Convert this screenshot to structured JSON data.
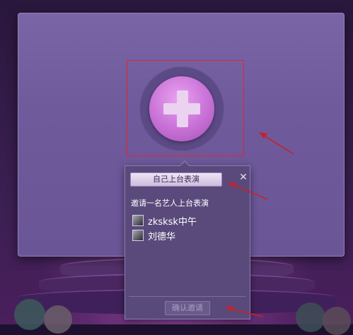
{
  "stage": {
    "add_button_icon": "plus-icon",
    "colors": {
      "panel": "#6f5a9c",
      "add_button": "#c870d6",
      "highlight_box": "#e0262c",
      "popup": "#5a4a7c",
      "annotation_arrow": "#c8202a"
    }
  },
  "popup": {
    "self_perform_label": "自己上台表演",
    "close_icon": "close-icon",
    "close_glyph": "✕",
    "invite_title": "邀请一名艺人上台表演",
    "artists": [
      {
        "name": "zksksk中午",
        "avatar_icon": "user-avatar-icon"
      },
      {
        "name": "刘德华",
        "avatar_icon": "user-avatar-icon"
      }
    ],
    "confirm_label": "确认邀请"
  }
}
